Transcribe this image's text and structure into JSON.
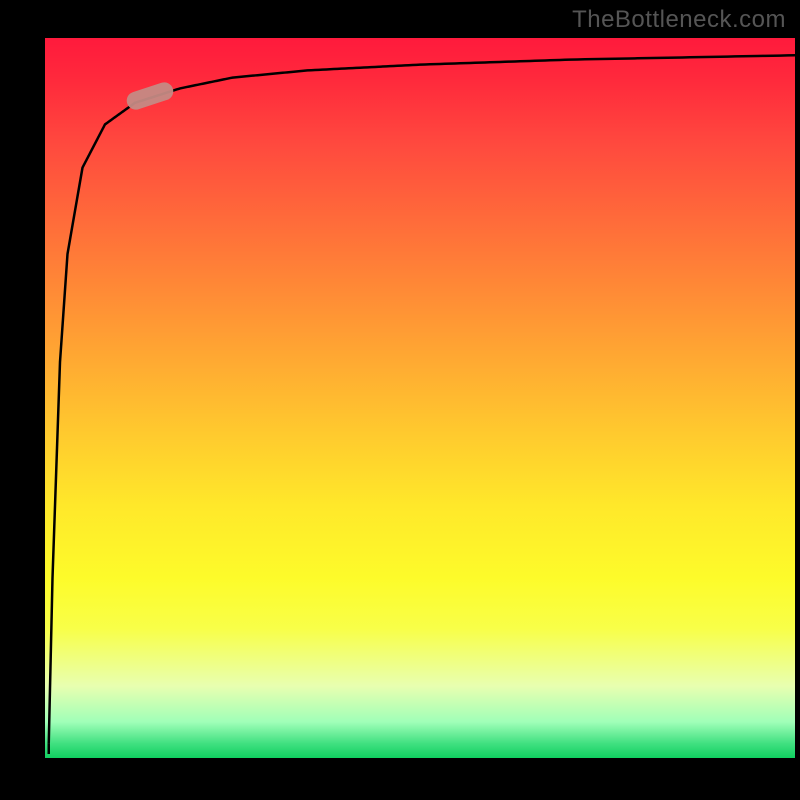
{
  "attribution": "TheBottleneck.com",
  "chart_data": {
    "type": "line",
    "title": "",
    "xlabel": "",
    "ylabel": "",
    "x_range": [
      0,
      100
    ],
    "y_range": [
      0,
      100
    ],
    "curve": {
      "description": "sharp logarithmic rise from near zero at left edge, asymptotically approaching top",
      "x": [
        0.5,
        1,
        2,
        3,
        5,
        8,
        12,
        18,
        25,
        35,
        50,
        70,
        100
      ],
      "y": [
        2,
        25,
        55,
        70,
        82,
        88,
        91,
        93,
        94.5,
        95.5,
        96.3,
        97,
        97.6
      ]
    },
    "marker": {
      "x": 14,
      "y": 92,
      "color": "#c58a84"
    },
    "gradient_colors": {
      "top": "#ff1a3c",
      "mid_upper": "#ff8a36",
      "mid": "#ffe82a",
      "mid_lower": "#f8ff48",
      "bottom": "#10d060"
    }
  }
}
